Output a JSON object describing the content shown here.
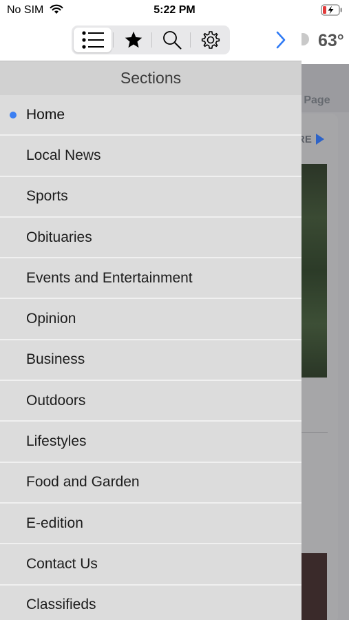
{
  "status_bar": {
    "carrier": "No SIM",
    "time": "5:22 PM"
  },
  "toolbar": {
    "segments": [
      {
        "name": "sections",
        "icon": "list-icon",
        "selected": true
      },
      {
        "name": "favorites",
        "icon": "star-icon",
        "selected": false
      },
      {
        "name": "search",
        "icon": "search-icon",
        "selected": false
      },
      {
        "name": "settings",
        "icon": "gear-icon",
        "selected": false
      }
    ],
    "next_icon": "chevron-right-icon"
  },
  "panel": {
    "title": "Sections",
    "items": [
      {
        "label": "Home",
        "active": true
      },
      {
        "label": "Local News",
        "active": false
      },
      {
        "label": "Sports",
        "active": false
      },
      {
        "label": "Obituaries",
        "active": false
      },
      {
        "label": "Events and Entertainment",
        "active": false
      },
      {
        "label": "Opinion",
        "active": false
      },
      {
        "label": "Business",
        "active": false
      },
      {
        "label": "Outdoors",
        "active": false
      },
      {
        "label": "Lifestyles",
        "active": false
      },
      {
        "label": "Food and Garden",
        "active": false
      },
      {
        "label": "E-edition",
        "active": false
      },
      {
        "label": "Contact Us",
        "active": false
      },
      {
        "label": "Classifieds",
        "active": false
      }
    ]
  },
  "background": {
    "temperature": "63°",
    "page_link": "e Page",
    "more_link": "RE"
  },
  "colors": {
    "accent": "#3b7ff2",
    "panel_bg": "#dcdcdc",
    "header_bg": "#d1d1d1"
  }
}
